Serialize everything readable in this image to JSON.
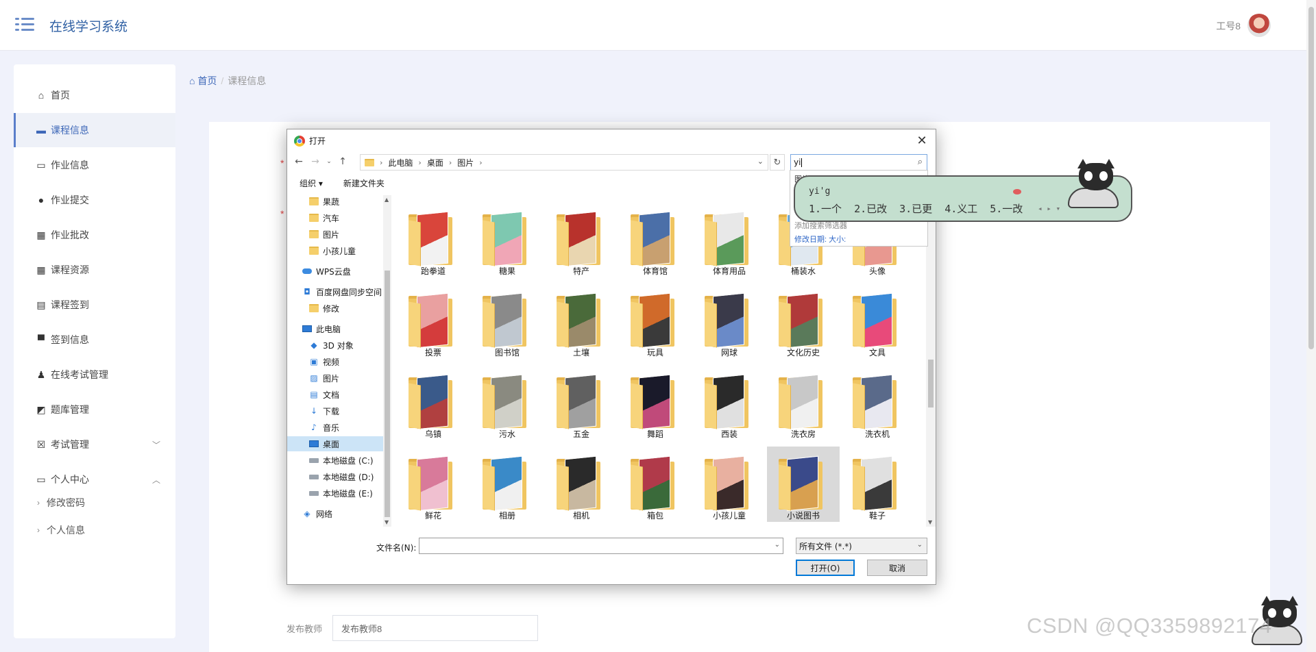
{
  "header": {
    "app_title": "在线学习系统",
    "user_name": "工号8"
  },
  "sidebar": {
    "items": [
      {
        "label": "首页",
        "icon": "home-icon"
      },
      {
        "label": "课程信息",
        "icon": "ticket-icon",
        "active": true
      },
      {
        "label": "作业信息",
        "icon": "briefcase-icon"
      },
      {
        "label": "作业提交",
        "icon": "bulb-icon"
      },
      {
        "label": "作业批改",
        "icon": "grid-icon"
      },
      {
        "label": "课程资源",
        "icon": "grid-icon"
      },
      {
        "label": "课程签到",
        "icon": "clipboard-icon"
      },
      {
        "label": "签到信息",
        "icon": "monitor-icon"
      },
      {
        "label": "在线考试管理",
        "icon": "user-icon"
      },
      {
        "label": "题库管理",
        "icon": "chart-icon"
      },
      {
        "label": "考试管理",
        "icon": "checklist-icon",
        "caret": "down"
      },
      {
        "label": "个人中心",
        "icon": "card-icon",
        "caret": "up"
      }
    ],
    "sub_items": [
      {
        "label": "修改密码"
      },
      {
        "label": "个人信息"
      }
    ]
  },
  "breadcrumb": {
    "home": "首页",
    "separator": "/",
    "current": "课程信息"
  },
  "form": {
    "teacher_label": "发布教师",
    "teacher_placeholder": "发布教师8"
  },
  "dialog": {
    "title": "打开",
    "address": {
      "segments": [
        "此电脑",
        "桌面",
        "图片"
      ]
    },
    "search_value": "yi",
    "toolbar": {
      "organize": "组织 ▾",
      "new_folder": "新建文件夹"
    },
    "tree": [
      {
        "label": "果蔬",
        "type": "folder",
        "indent": 1
      },
      {
        "label": "汽车",
        "type": "folder",
        "indent": 1
      },
      {
        "label": "图片",
        "type": "folder",
        "indent": 1
      },
      {
        "label": "小孩儿童",
        "type": "folder",
        "indent": 1
      },
      {
        "label": "WPS云盘",
        "type": "cloud",
        "indent": 0
      },
      {
        "label": "百度网盘同步空间",
        "type": "baidu",
        "indent": 0
      },
      {
        "label": "修改",
        "type": "folder",
        "indent": 1
      },
      {
        "label": "此电脑",
        "type": "pc",
        "indent": 0
      },
      {
        "label": "3D 对象",
        "type": "3d",
        "indent": 1
      },
      {
        "label": "视频",
        "type": "video",
        "indent": 1
      },
      {
        "label": "图片",
        "type": "picture",
        "indent": 1
      },
      {
        "label": "文档",
        "type": "doc",
        "indent": 1
      },
      {
        "label": "下载",
        "type": "download",
        "indent": 1
      },
      {
        "label": "音乐",
        "type": "music",
        "indent": 1
      },
      {
        "label": "桌面",
        "type": "desktop",
        "indent": 1,
        "selected": true
      },
      {
        "label": "本地磁盘 (C:)",
        "type": "drive",
        "indent": 1
      },
      {
        "label": "本地磁盘 (D:)",
        "type": "drive",
        "indent": 1
      },
      {
        "label": "本地磁盘 (E:)",
        "type": "drive",
        "indent": 1
      },
      {
        "label": "网络",
        "type": "network",
        "indent": 0
      }
    ],
    "folders": [
      {
        "label": "跆拳道",
        "colors": [
          "#d9453b",
          "#f2f2f2"
        ]
      },
      {
        "label": "糖果",
        "colors": [
          "#7ec8b0",
          "#f0a6b6"
        ]
      },
      {
        "label": "特产",
        "colors": [
          "#b8322c",
          "#e9d6b0"
        ]
      },
      {
        "label": "体育馆",
        "colors": [
          "#4b6fa8",
          "#c8a070"
        ]
      },
      {
        "label": "体育用品",
        "colors": [
          "#e8e8e8",
          "#5a9a5a"
        ]
      },
      {
        "label": "桶装水",
        "colors": [
          "#6aa8d8",
          "#e0e8f0"
        ]
      },
      {
        "label": "头像",
        "colors": [
          "#f0d0b0",
          "#e89890"
        ]
      },
      {
        "label": "投票",
        "colors": [
          "#e9a0a0",
          "#d43c3c"
        ]
      },
      {
        "label": "图书馆",
        "colors": [
          "#8a8a8a",
          "#c0c8d0"
        ]
      },
      {
        "label": "土壤",
        "colors": [
          "#4a6a3a",
          "#9a8a6a"
        ]
      },
      {
        "label": "玩具",
        "colors": [
          "#d06a2a",
          "#3a3a3a"
        ]
      },
      {
        "label": "网球",
        "colors": [
          "#3a3a4a",
          "#6a8ac8"
        ]
      },
      {
        "label": "文化历史",
        "colors": [
          "#b03a3a",
          "#5a7a5a"
        ]
      },
      {
        "label": "文具",
        "colors": [
          "#3a8ad8",
          "#e84a7a"
        ]
      },
      {
        "label": "乌镇",
        "colors": [
          "#3a5a8a",
          "#b04040"
        ]
      },
      {
        "label": "污水",
        "colors": [
          "#8a8a80",
          "#d0d0c8"
        ]
      },
      {
        "label": "五金",
        "colors": [
          "#606060",
          "#a0a0a0"
        ]
      },
      {
        "label": "舞蹈",
        "colors": [
          "#1a1a2a",
          "#c04a7a"
        ]
      },
      {
        "label": "西装",
        "colors": [
          "#2a2a2a",
          "#e0e0e0"
        ]
      },
      {
        "label": "洗衣房",
        "colors": [
          "#c8c8c8",
          "#f0f0f0"
        ]
      },
      {
        "label": "洗衣机",
        "colors": [
          "#5a6a8a",
          "#e8e8f0"
        ]
      },
      {
        "label": "鲜花",
        "colors": [
          "#d87a9a",
          "#f0c0d0"
        ]
      },
      {
        "label": "相册",
        "colors": [
          "#3a8ac8",
          "#f0f0f0"
        ]
      },
      {
        "label": "相机",
        "colors": [
          "#2a2a2a",
          "#c8b8a0"
        ]
      },
      {
        "label": "箱包",
        "colors": [
          "#b03a4a",
          "#3a6a3a"
        ]
      },
      {
        "label": "小孩儿童",
        "colors": [
          "#e8b0a0",
          "#3a2a2a"
        ]
      },
      {
        "label": "小说图书",
        "colors": [
          "#3a4a8a",
          "#d8a050"
        ],
        "selected": true
      },
      {
        "label": "鞋子",
        "colors": [
          "#e0e0e0",
          "#3a3a3a"
        ]
      }
    ],
    "filename_label": "文件名(N):",
    "filename_value": "",
    "filetype_value": "所有文件 (*.*)",
    "open_label": "打开(O)",
    "cancel_label": "取消"
  },
  "search_panel": {
    "line1": "图片",
    "line2": "添加搜索筛选器",
    "line3": "修改日期:    大小:"
  },
  "ime": {
    "composition": "yi'g",
    "candidates": [
      "1.一个",
      "2.已改",
      "3.已更",
      "4.义工",
      "5.一改"
    ]
  },
  "watermark": "CSDN @QQ3359892174"
}
